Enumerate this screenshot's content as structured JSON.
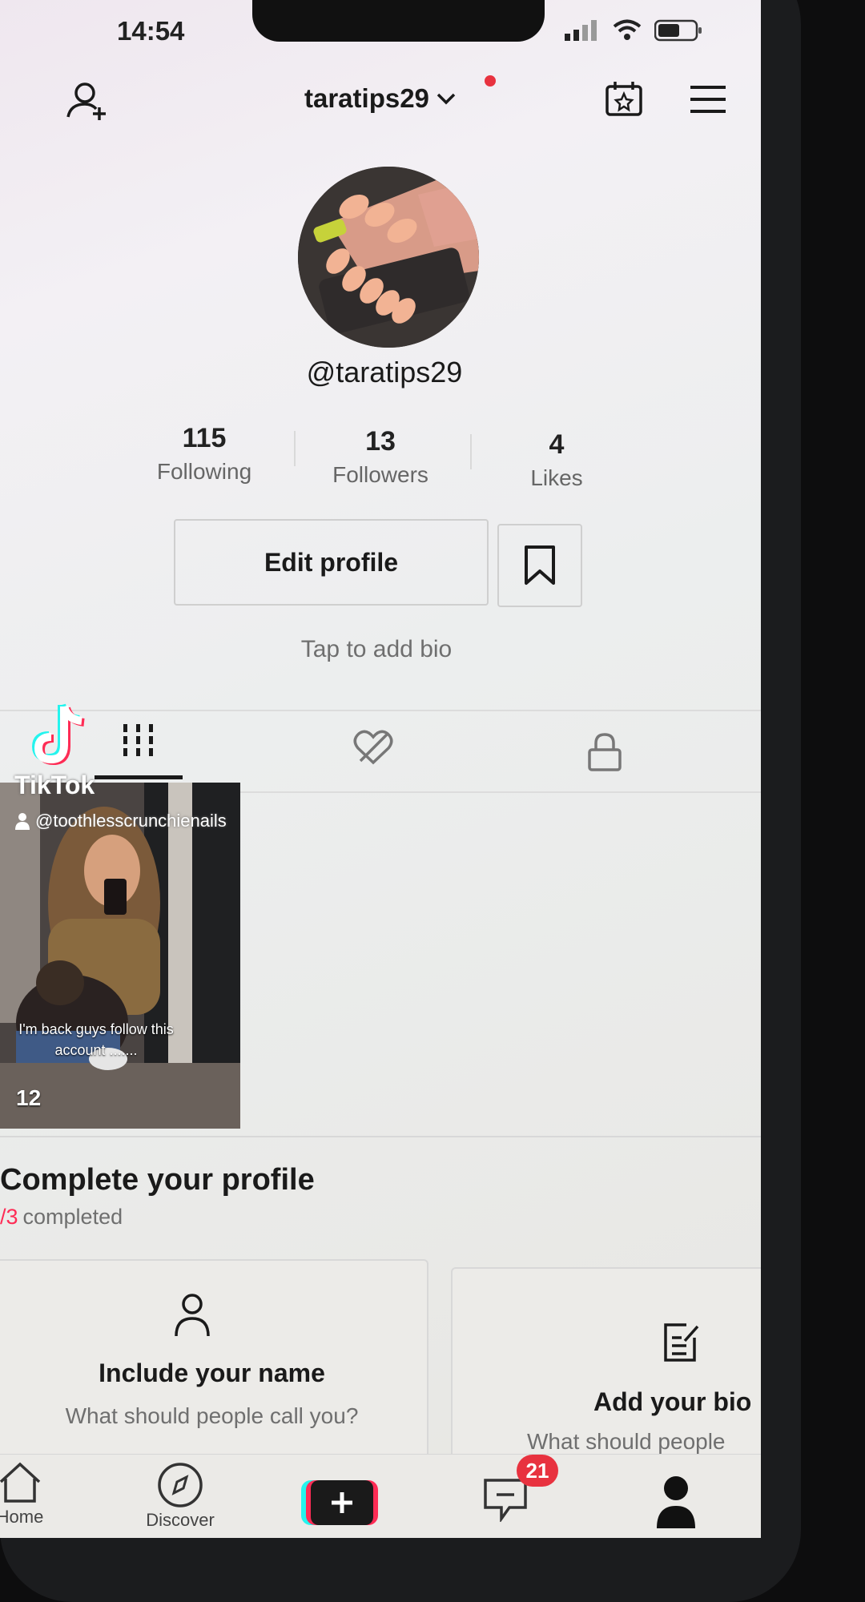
{
  "status_bar": {
    "time": "14:54"
  },
  "header": {
    "username": "taratips29"
  },
  "profile": {
    "handle": "@taratips29",
    "stats": [
      {
        "value": "115",
        "label": "Following"
      },
      {
        "value": "13",
        "label": "Followers"
      },
      {
        "value": "4",
        "label": "Likes"
      }
    ],
    "edit_button": "Edit profile",
    "bio_prompt": "Tap to add bio"
  },
  "video": {
    "watermark": "TikTok",
    "author": "@toothlesscrunchienails",
    "caption_line1": "I'm back guys follow this",
    "caption_line2": "account .......",
    "views": "12"
  },
  "complete_profile": {
    "title": "Complete your profile",
    "progress_num": "/3",
    "progress_text": "completed",
    "cards": [
      {
        "title": "Include your name",
        "subtitle": "What should people call you?"
      },
      {
        "title": "Add your bio",
        "subtitle": "What should people"
      }
    ]
  },
  "bottom_nav": {
    "home": "Home",
    "discover": "Discover",
    "inbox_badge": "21"
  },
  "colors": {
    "accent": "#fe2c55",
    "text": "#1a1a1a",
    "muted": "#6f6f6f"
  }
}
